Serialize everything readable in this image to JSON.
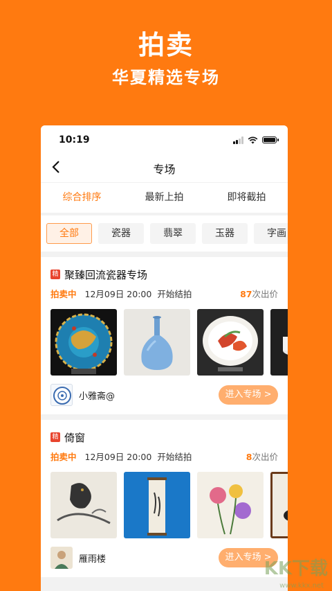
{
  "promo": {
    "title": "拍卖",
    "subtitle": "华夏精选专场"
  },
  "status": {
    "time": "10:19"
  },
  "nav": {
    "back_icon": "chevron-left-icon",
    "title": "专场"
  },
  "sort_tabs": [
    {
      "label": "综合排序",
      "active": true
    },
    {
      "label": "最新上拍",
      "active": false
    },
    {
      "label": "即将截拍",
      "active": false
    }
  ],
  "categories": [
    {
      "label": "全部",
      "active": true
    },
    {
      "label": "瓷器",
      "active": false
    },
    {
      "label": "翡翠",
      "active": false
    },
    {
      "label": "玉器",
      "active": false
    },
    {
      "label": "字画",
      "active": false
    }
  ],
  "sessions": [
    {
      "badge": "精",
      "title": "聚臻回流瓷器专场",
      "status": "拍卖中",
      "date": "12月09日 20:00",
      "start_text": "开始结拍",
      "bid_count": "87",
      "bid_suffix": "次出价",
      "shop": "小雅斋@",
      "button": "进入专场 >"
    },
    {
      "badge": "精",
      "title": "倚窗",
      "status": "拍卖中",
      "date": "12月09日 20:00",
      "start_text": "开始结拍",
      "bid_count": "8",
      "bid_suffix": "次出价",
      "shop": "雁雨楼",
      "button": "进入专场 >"
    }
  ],
  "watermark": {
    "text": "KK下载",
    "url": "www.kkx.net"
  }
}
